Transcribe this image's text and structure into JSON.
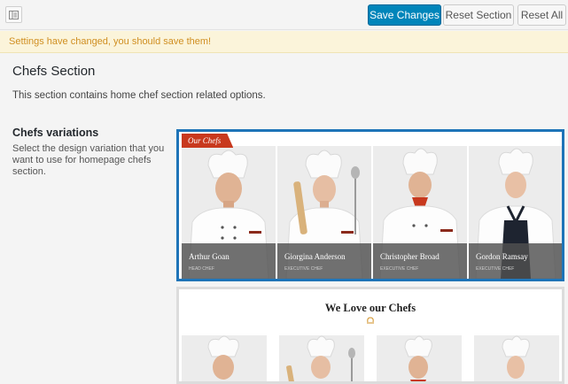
{
  "toolbar": {
    "save_label": "Save Changes",
    "reset_section_label": "Reset Section",
    "reset_all_label": "Reset All"
  },
  "notice": {
    "text": "Settings have changed, you should save them!"
  },
  "section": {
    "title": "Chefs Section",
    "description": "This section contains home chef section related options."
  },
  "field": {
    "title": "Chefs variations",
    "description": "Select the design variation that you want to use for homepage chefs section."
  },
  "variation1": {
    "tag": "Our Chefs",
    "selected": true,
    "chefs": [
      {
        "name": "Arthur Goan",
        "role": "HEAD CHEF"
      },
      {
        "name": "Giorgina Anderson",
        "role": "EXECUTIVE CHEF"
      },
      {
        "name": "Christopher Broad",
        "role": "EXECUTIVE CHEF"
      },
      {
        "name": "Gordon Ramsay",
        "role": "EXECUTIVE CHEF"
      }
    ]
  },
  "variation2": {
    "title": "We Love our Chefs",
    "selected": false
  },
  "colors": {
    "primary": "#0085ba",
    "notice_text": "#d08f22",
    "notice_bg": "#fbf4da",
    "selected_border": "#1e74b8",
    "tag_bg": "#c8391e"
  }
}
